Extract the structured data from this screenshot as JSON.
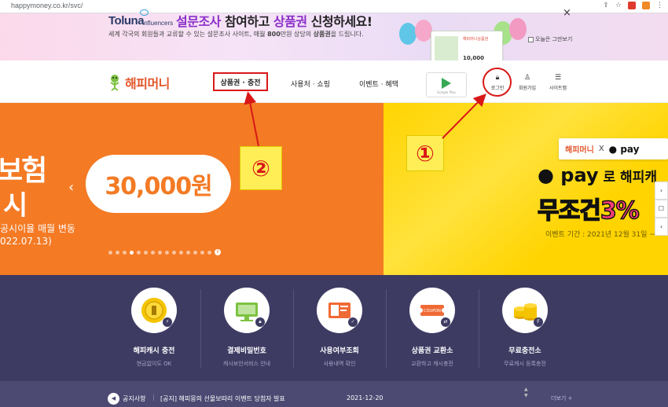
{
  "browser": {
    "url": "happymoney.co.kr/svc/"
  },
  "promo": {
    "brand": "Toluna",
    "brand_sub": "Influencers",
    "headline_a": "설문조사",
    "headline_b": " 참여하고 ",
    "headline_c": "상품권",
    "headline_d": " 신청하세요!",
    "sub_a": "세계 각국의 회원들과 교류할 수 있는 설문조사 사이트, 매월 ",
    "sub_b": "800",
    "sub_c": "만원 상당의 ",
    "sub_d": "상품권",
    "sub_e": "을 드립니다.",
    "card_label": "해피머니상품권",
    "card_amount": "10,000",
    "close": "×",
    "dismiss_today": "오늘은 그만보기",
    "colors": {
      "headline_highlight": "#8b2fc9"
    }
  },
  "header": {
    "logo_text": "해피머니",
    "nav": [
      "상품권 · 충전",
      "사용처 · 쇼핑",
      "이벤트 · 혜택"
    ],
    "google_play_label": "Google Play",
    "utils": [
      {
        "icon": "lock-icon",
        "label": "로그인"
      },
      {
        "icon": "person-icon",
        "label": "회원가입"
      },
      {
        "icon": "menu-icon",
        "label": "사이트맵"
      }
    ]
  },
  "hero": {
    "left": {
      "partial_line1": "보험",
      "partial_line2": "시",
      "amount": "30,000원",
      "note_line1": "공시이율 매월 변동",
      "note_line2": "022.07.13)",
      "prev": "‹",
      "slide_count": 15,
      "active_slide": 4,
      "pause": "II",
      "color": "#f47a24"
    },
    "right": {
      "badge_brand": "해피머니",
      "badge_x": "X",
      "badge_pay": "● pay",
      "line1_pay": "● pay",
      "line1_rest": " 로 해피캐",
      "line2_a": "무조건",
      "line2_b": "3%",
      "period": "이벤트 기간 : 2021년 12월 31일 ~",
      "color": "#ffd400"
    },
    "side_tabs": [
      "›",
      "☐",
      "‹"
    ]
  },
  "annotations": {
    "one": "①",
    "two": "②",
    "color": "#d81818"
  },
  "services": [
    {
      "title": "해피캐시 충전",
      "sub": "현금없이도 OK",
      "icon": "coin-icon"
    },
    {
      "title": "결제비밀번호",
      "sub": "캐시보안서비스 안내",
      "icon": "monitor-lock-icon"
    },
    {
      "title": "사용여부조회",
      "sub": "사용내역 확인",
      "icon": "receipt-check-icon"
    },
    {
      "title": "상품권 교환소",
      "sub": "교환하고 캐시충전",
      "icon": "coupon-exchange-icon"
    },
    {
      "title": "무료충전소",
      "sub": "무료캐시 등록충전",
      "icon": "coin-stack-icon"
    }
  ],
  "notice": {
    "label": "공지사항",
    "sep": "|",
    "text": "[공지] 해피몽의 선물보따리 이벤트 당첨자 발표",
    "date": "2021-12-20",
    "more": "더보기 +"
  }
}
